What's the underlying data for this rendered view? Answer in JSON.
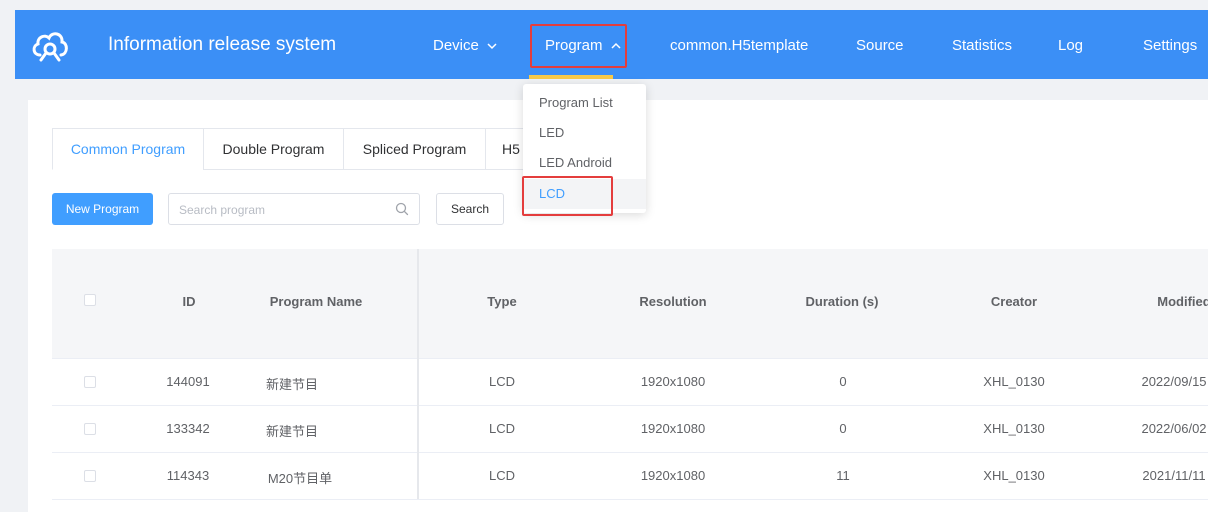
{
  "header": {
    "title": "Information release system",
    "logo_icon": "cloud-icon",
    "nav": [
      {
        "label": "Device",
        "icon": "chevron-down-icon"
      },
      {
        "label": "Program",
        "icon": "chevron-up-icon"
      },
      {
        "label": "common.H5template"
      },
      {
        "label": "Source"
      },
      {
        "label": "Statistics"
      },
      {
        "label": "Log"
      },
      {
        "label": "Settings"
      }
    ]
  },
  "dropdown": {
    "items": [
      {
        "label": "Program List"
      },
      {
        "label": "LED"
      },
      {
        "label": "LED Android"
      },
      {
        "label": "LCD"
      }
    ]
  },
  "tabs": [
    {
      "label": "Common Program"
    },
    {
      "label": "Double Program"
    },
    {
      "label": "Spliced Program"
    },
    {
      "label": "H5"
    }
  ],
  "toolbar": {
    "new_program": "New Program",
    "search_placeholder": "Search program",
    "search_button": "Search"
  },
  "table": {
    "headers": [
      "ID",
      "Program Name",
      "Type",
      "Resolution",
      "Duration (s)",
      "Creator",
      "Modified"
    ],
    "rows": [
      [
        "144091",
        "新建节目",
        "LCD",
        "1920x1080",
        "0",
        "XHL_0130",
        "2022/09/15"
      ],
      [
        "133342",
        "新建节目",
        "LCD",
        "1920x1080",
        "0",
        "XHL_0130",
        "2022/06/02"
      ],
      [
        "114343",
        "M20节目单",
        "LCD",
        "1920x1080",
        "11",
        "XHL_0130",
        "2021/11/11"
      ]
    ]
  },
  "colors": {
    "header_bg": "#3b8ff6",
    "primary": "#409eff",
    "highlight": "#e43d3d",
    "nav_underline": "#f7c948"
  }
}
